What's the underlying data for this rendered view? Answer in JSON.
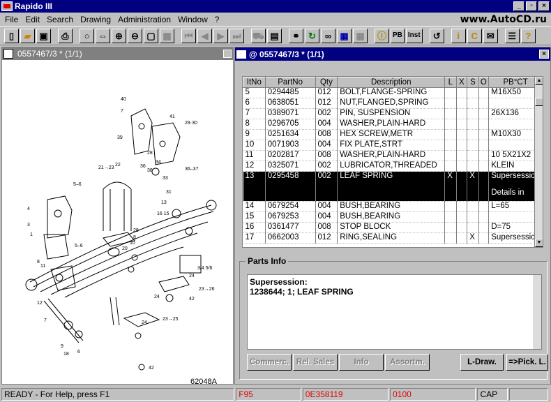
{
  "app": {
    "title": "Rapido III",
    "brand": "www.AutoCD.ru",
    "win_buttons": [
      "_",
      "▫",
      "×"
    ]
  },
  "menu": [
    "File",
    "Edit",
    "Search",
    "Drawing",
    "Administration",
    "Window",
    "?"
  ],
  "toolbar": {
    "pb_label": "PB",
    "inst_label": "Inst"
  },
  "left": {
    "title": "0557467/3 * (1/1)",
    "diagram_code": "62048A"
  },
  "right": {
    "title": "@ 0557467/3 * (1/1)",
    "columns": [
      "ItNo",
      "PartNo",
      "Qty",
      "Description",
      "L",
      "X",
      "S",
      "O",
      "PB°CT"
    ],
    "rows": [
      {
        "it": "5",
        "part": "0294485",
        "qty": "012",
        "desc": "BOLT,FLANGE-SPRING",
        "l": "",
        "x": "",
        "s": "",
        "o": "",
        "pb": "M16X50"
      },
      {
        "it": "6",
        "part": "0638051",
        "qty": "012",
        "desc": "NUT,FLANGED,SPRING",
        "l": "",
        "x": "",
        "s": "",
        "o": "",
        "pb": ""
      },
      {
        "it": "7",
        "part": "0389071",
        "qty": "002",
        "desc": "PIN, SUSPENSION",
        "l": "",
        "x": "",
        "s": "",
        "o": "",
        "pb": "26X136"
      },
      {
        "it": "8",
        "part": "0296705",
        "qty": "004",
        "desc": "WASHER,PLAIN-HARD",
        "l": "",
        "x": "",
        "s": "",
        "o": "",
        "pb": ""
      },
      {
        "it": "9",
        "part": "0251634",
        "qty": "008",
        "desc": "HEX SCREW,METR",
        "l": "",
        "x": "",
        "s": "",
        "o": "",
        "pb": "M10X30"
      },
      {
        "it": "10",
        "part": "0071903",
        "qty": "004",
        "desc": "FIX PLATE,STRT",
        "l": "",
        "x": "",
        "s": "",
        "o": "",
        "pb": ""
      },
      {
        "it": "11",
        "part": "0202817",
        "qty": "008",
        "desc": "WASHER,PLAIN-HARD",
        "l": "",
        "x": "",
        "s": "",
        "o": "",
        "pb": "10 5X21X2"
      },
      {
        "it": "12",
        "part": "0325071",
        "qty": "002",
        "desc": "LUBRICATOR,THREADED",
        "l": "",
        "x": "",
        "s": "",
        "o": "",
        "pb": "KLEIN"
      },
      {
        "it": "13",
        "part": "0295458",
        "qty": "002",
        "desc": "LEAF SPRING",
        "l": "X",
        "x": "",
        "s": "X",
        "o": "",
        "pb": "Supersession",
        "pb2": "Details in",
        "selected": true
      },
      {
        "it": "14",
        "part": "0679254",
        "qty": "004",
        "desc": "BUSH,BEARING",
        "l": "",
        "x": "",
        "s": "",
        "o": "",
        "pb": "L=65"
      },
      {
        "it": "15",
        "part": "0679253",
        "qty": "004",
        "desc": "BUSH,BEARING",
        "l": "",
        "x": "",
        "s": "",
        "o": "",
        "pb": ""
      },
      {
        "it": "16",
        "part": "0361477",
        "qty": "008",
        "desc": "STOP BLOCK",
        "l": "",
        "x": "",
        "s": "",
        "o": "",
        "pb": "D=75"
      },
      {
        "it": "17",
        "part": "0662003",
        "qty": "012",
        "desc": "RING,SEALING",
        "l": "",
        "x": "",
        "s": "X",
        "o": "",
        "pb": "Supersession"
      }
    ]
  },
  "parts_info": {
    "label": "Parts Info",
    "line1": "Supersession:",
    "line2": "1238644; 1; LEAF SPRING",
    "buttons": {
      "commerc": "Commerc.",
      "rel_sales": "Rel. Sales",
      "info": "Info",
      "assortm": "Assortm.",
      "ldraw": "L-Draw.",
      "pickl": "=>Pick. L."
    }
  },
  "status": {
    "ready": "READY - For Help, press F1",
    "f": "F95",
    "code": "0E358119",
    "num": "0100",
    "cap": "CAP"
  }
}
